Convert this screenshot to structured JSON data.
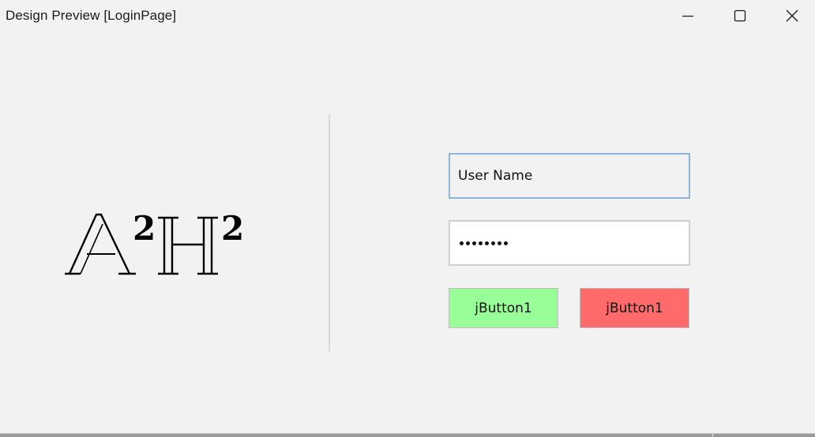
{
  "window": {
    "title": "Design Preview [LoginPage]",
    "controls": {
      "minimize": "minimize-icon",
      "maximize": "maximize-icon",
      "close": "close-icon"
    }
  },
  "logo": {
    "text": "A²H²",
    "letters": [
      "A",
      "2",
      "H",
      "2"
    ]
  },
  "form": {
    "username_value": "User Name",
    "password_mask_length": 8,
    "buttons": [
      {
        "label": "jButton1",
        "color": "#98ff98"
      },
      {
        "label": "jButton1",
        "color": "#ff6b6b"
      }
    ]
  },
  "colors": {
    "window_bg": "#f2f2f2",
    "focus_border": "#8cb4dc",
    "green_button": "#98ff98",
    "red_button": "#ff6b6b"
  }
}
